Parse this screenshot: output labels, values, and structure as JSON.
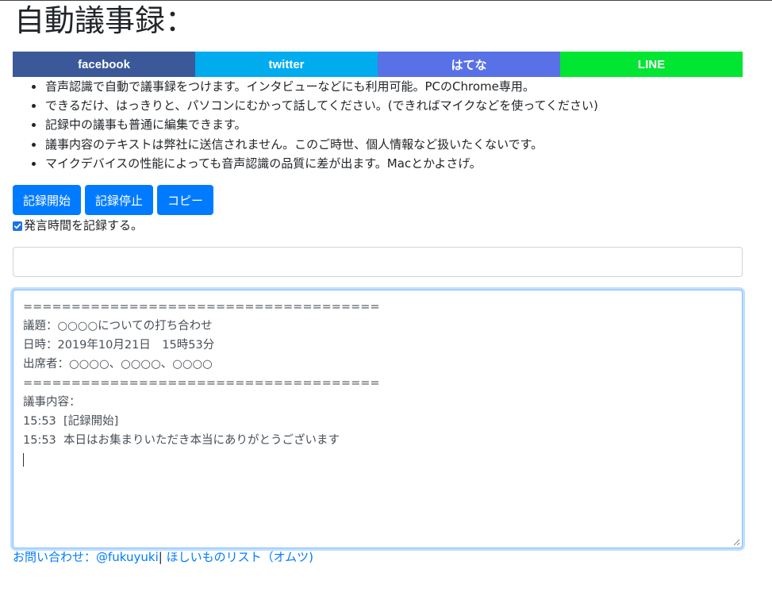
{
  "page": {
    "title": "自動議事録："
  },
  "share": [
    {
      "label": "facebook",
      "color": "#3b5998"
    },
    {
      "label": "twitter",
      "color": "#00acee"
    },
    {
      "label": "はてな",
      "color": "#5971e6"
    },
    {
      "label": "LINE",
      "color": "#00e632"
    }
  ],
  "notes": [
    "音声認識で自動で議事録をつけます。インタビューなどにも利用可能。PCのChrome専用。",
    "できるだけ、はっきりと、パソコンにむかって話してください。(できればマイクなどを使ってください)",
    "記録中の議事も普通に編集できます。",
    "議事内容のテキストは弊社に送信されません。このご時世、個人情報など扱いたくないです。",
    "マイクデバイスの性能によっても音声認識の品質に差が出ます。Macとかよさげ。"
  ],
  "buttons": {
    "start": "記録開始",
    "stop": "記録停止",
    "copy": "コピー"
  },
  "options": {
    "record_time_label": "発言時間を記録する。",
    "record_time_checked": true
  },
  "speech_input": {
    "value": "",
    "placeholder": ""
  },
  "minutes_text": "=====================================\n議題：○○○○についての打ち合わせ\n日時：2019年10月21日　15時53分\n出席者：○○○○、○○○○、○○○○\n=====================================\n議事内容：\n15:53  [記録開始]\n15:53  本日はお集まりいただき本当にありがとうございます\n",
  "footer": {
    "contact_label": "お問い合わせ：",
    "contact_link": "@fukuyuki",
    "separator": "|",
    "wishlist_link": " ほしいものリスト（オムツ)"
  },
  "colors": {
    "primary": "#007bff",
    "focus_border": "#80bdff"
  }
}
